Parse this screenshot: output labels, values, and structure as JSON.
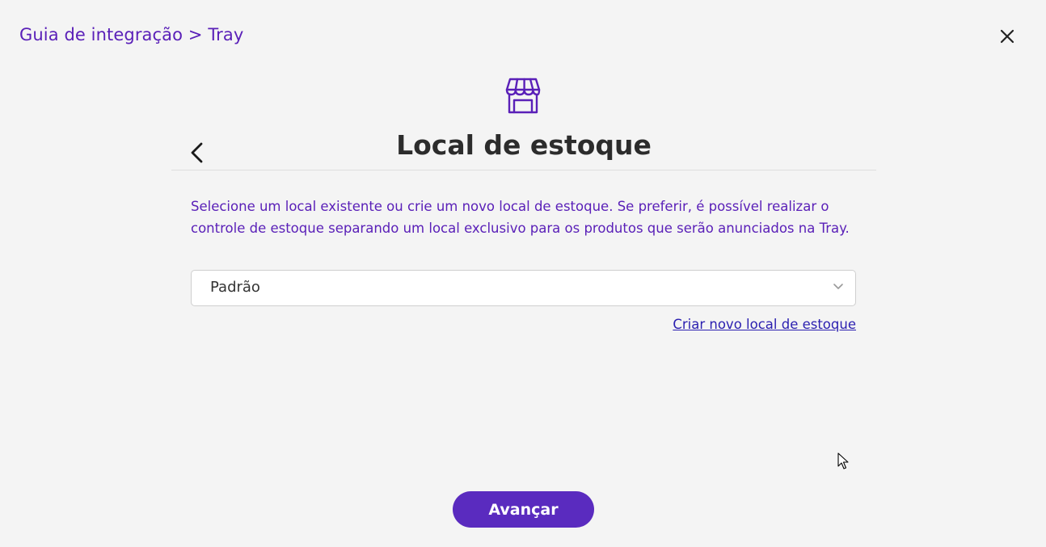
{
  "header": {
    "breadcrumb": "Guia de integração > Tray",
    "close_icon": "close-icon"
  },
  "step": {
    "icon": "store-icon",
    "back_icon": "chevron-left-icon",
    "title": "Local de estoque",
    "description": "Selecione um local existente ou crie um novo local de estoque. Se preferir, é possível realizar o controle de estoque separando um local exclusivo para os produtos que serão anunciados na Tray."
  },
  "stock_location_select": {
    "selected_value": "Padrão",
    "chevron_icon": "chevron-down-icon"
  },
  "create_link": {
    "label": "Criar novo local de estoque"
  },
  "footer": {
    "next_button_label": "Avançar"
  },
  "colors": {
    "accent": "#5a20b8",
    "button": "#5a2bbf",
    "link": "#2b1fb0",
    "background": "#f4f4f4"
  }
}
